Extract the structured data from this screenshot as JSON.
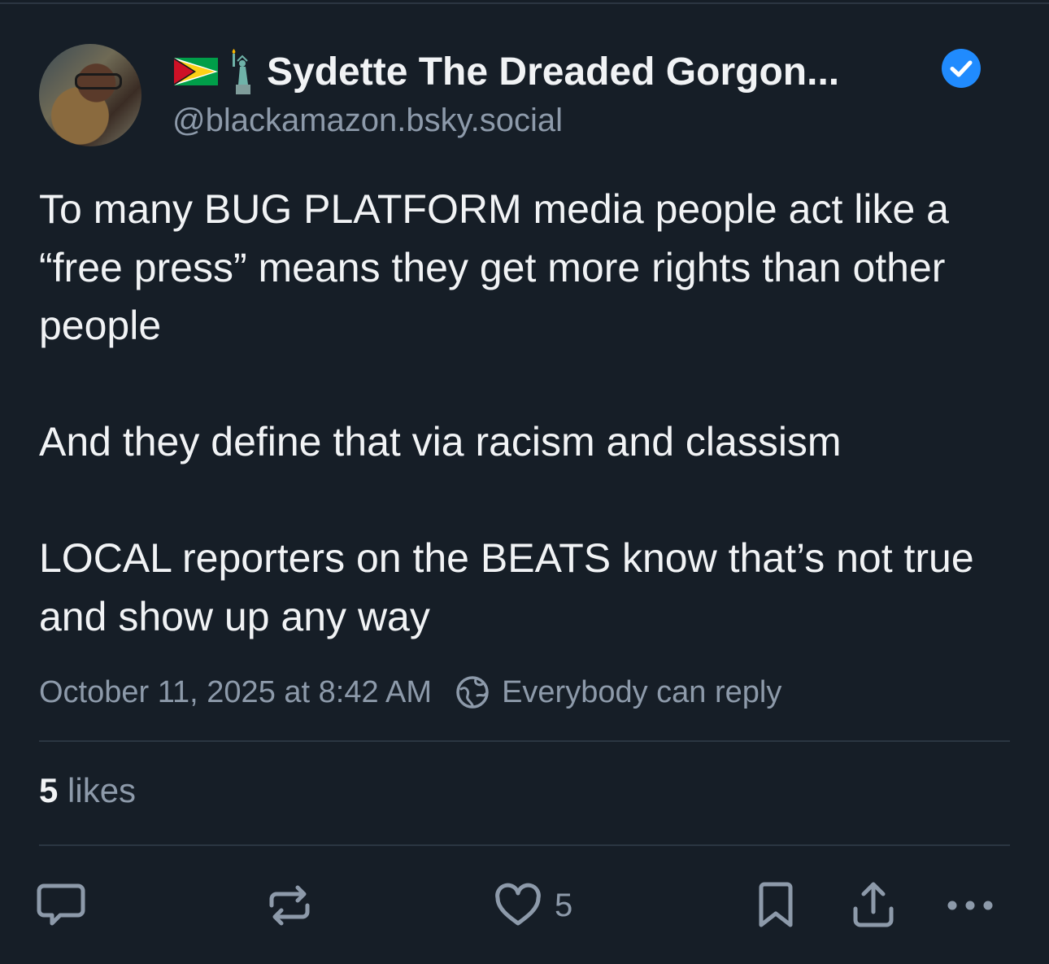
{
  "author": {
    "display_name": "Sydette The Dreaded Gorgon...",
    "handle": "@blackamazon.bsky.social",
    "emoji": [
      "guyana-flag",
      "statue-of-liberty"
    ],
    "verified": true
  },
  "post": {
    "paragraphs": [
      "To many BUG PLATFORM media people act like a “free press” means they get more rights than other people",
      "And they define that via racism and classism",
      "LOCAL reporters on the BEATS know that’s not true and show up any way"
    ],
    "timestamp": "October 11, 2025 at 8:42 AM",
    "reply_setting": "Everybody can reply"
  },
  "stats": {
    "likes_count": "5",
    "likes_label": " likes"
  },
  "actions": {
    "reply_icon": "speech-bubble-icon",
    "repost_icon": "repost-icon",
    "like_icon": "heart-icon",
    "like_count": "5",
    "bookmark_icon": "bookmark-icon",
    "share_icon": "share-icon",
    "more_icon": "more-icon"
  },
  "colors": {
    "background": "#161e27",
    "text": "#f1f3f5",
    "muted": "#8d9aaa",
    "verified": "#208bfe",
    "divider": "#2b3642"
  }
}
